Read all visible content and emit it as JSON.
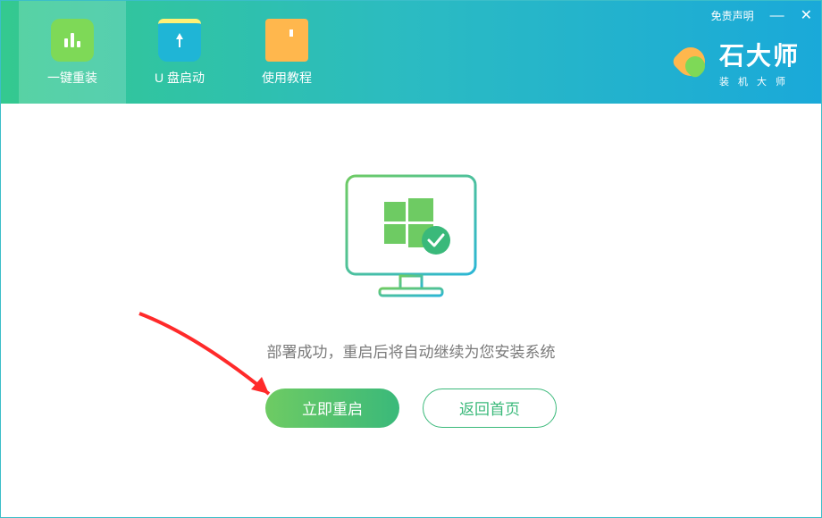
{
  "window": {
    "disclaimer": "免责声明"
  },
  "nav": {
    "items": [
      {
        "label": "一键重装"
      },
      {
        "label": "U 盘启动"
      },
      {
        "label": "使用教程"
      }
    ]
  },
  "brand": {
    "title": "石大师",
    "subtitle": "装机大师"
  },
  "main": {
    "status_text": "部署成功，重启后将自动继续为您安装系统",
    "primary_button": "立即重启",
    "secondary_button": "返回首页"
  }
}
